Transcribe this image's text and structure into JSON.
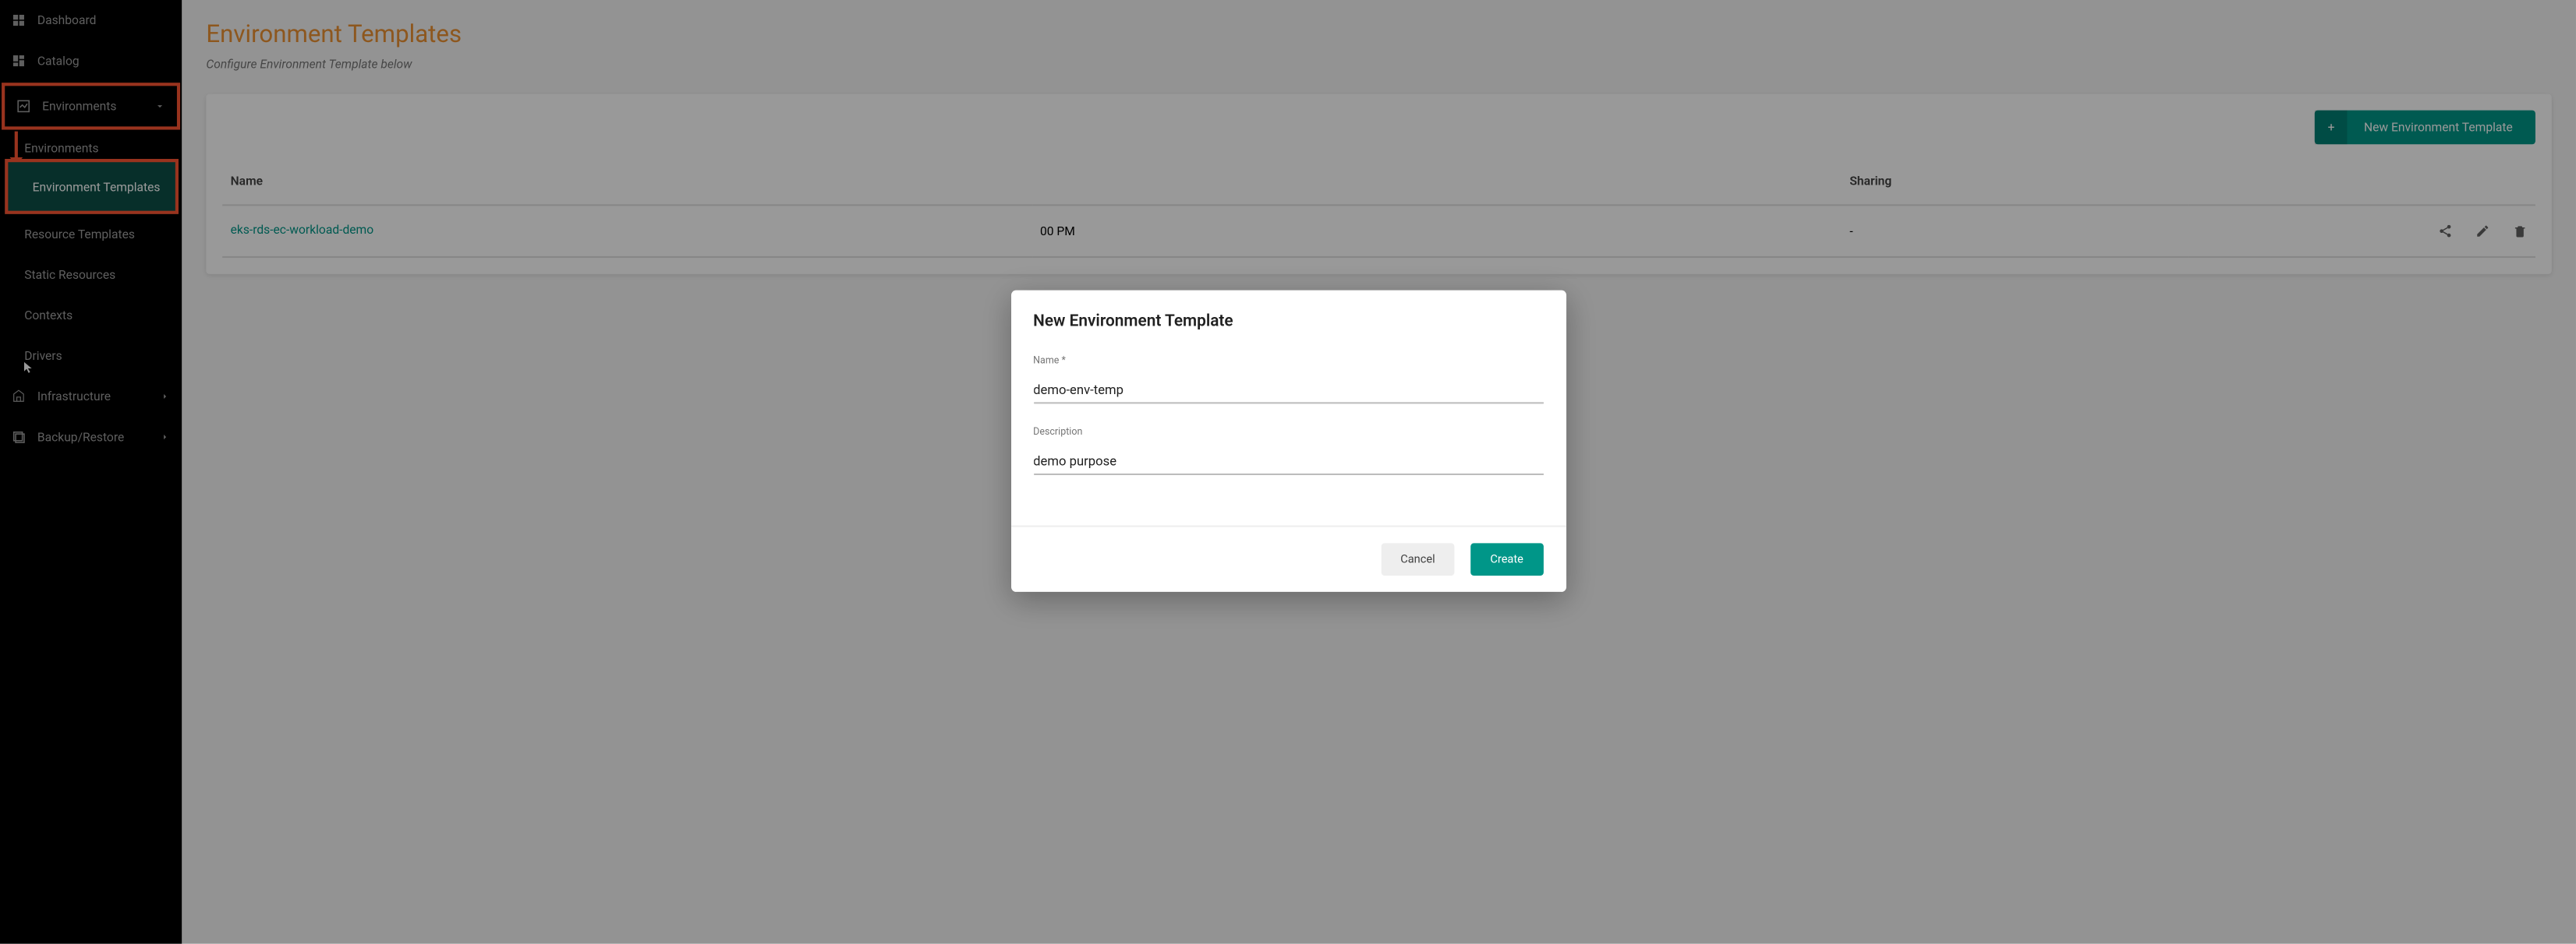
{
  "sidebar": {
    "items": [
      {
        "label": "Dashboard",
        "icon": "dashboard"
      },
      {
        "label": "Catalog",
        "icon": "catalog"
      },
      {
        "label": "Environments",
        "icon": "environments",
        "expanded": true,
        "highlighted": true
      },
      {
        "label": "Infrastructure",
        "icon": "infrastructure",
        "expandable": true
      },
      {
        "label": "Backup/Restore",
        "icon": "backup",
        "expandable": true
      }
    ],
    "env_subitems": [
      {
        "label": "Environments"
      },
      {
        "label": "Environment Templates",
        "active": true,
        "highlighted": true
      },
      {
        "label": "Resource Templates"
      },
      {
        "label": "Static Resources"
      },
      {
        "label": "Contexts"
      },
      {
        "label": "Drivers"
      }
    ]
  },
  "page": {
    "title": "Environment Templates",
    "subtitle": "Configure Environment Template below",
    "new_button": "New Environment Template"
  },
  "table": {
    "headers": {
      "name": "Name",
      "sharing": "Sharing"
    },
    "row": {
      "name": "eks-rds-ec-workload-demo",
      "time_fragment": "00 PM",
      "sharing": "-"
    }
  },
  "modal": {
    "title": "New Environment Template",
    "name_label": "Name *",
    "name_value": "demo-env-temp",
    "description_label": "Description",
    "description_value": "demo purpose",
    "cancel": "Cancel",
    "create": "Create"
  }
}
